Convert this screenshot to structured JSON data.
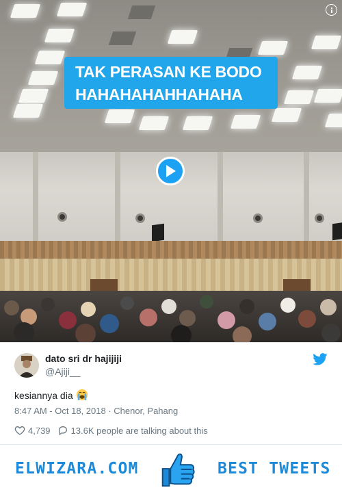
{
  "video": {
    "caption_line1": "TAK PERASAN KE BODO",
    "caption_line2": "HAHAHAHAHHAHAHA",
    "play_icon": "play-icon",
    "info_icon": "info-icon"
  },
  "tweet": {
    "author_name": "dato sri dr hajijiji",
    "author_handle": "@Ajiji__",
    "text": "kesiannya dia",
    "emoji": "loudly-crying-face-emoji",
    "timestamp": "8:47 AM - Oct 18, 2018",
    "separator": " · ",
    "location": "Chenor, Pahang",
    "likes": "4,739",
    "talking": "13.6K people are talking about this",
    "brand_icon": "twitter-bird-icon"
  },
  "banner": {
    "site": "ELWIZARA.COM",
    "tagline": "BEST TWEETS",
    "icon": "thumbs-up-icon"
  },
  "colors": {
    "accent": "#1da1f2",
    "caption_bg": "#21a6ec",
    "banner_text": "#1d8ad9",
    "muted_text": "#697882"
  }
}
